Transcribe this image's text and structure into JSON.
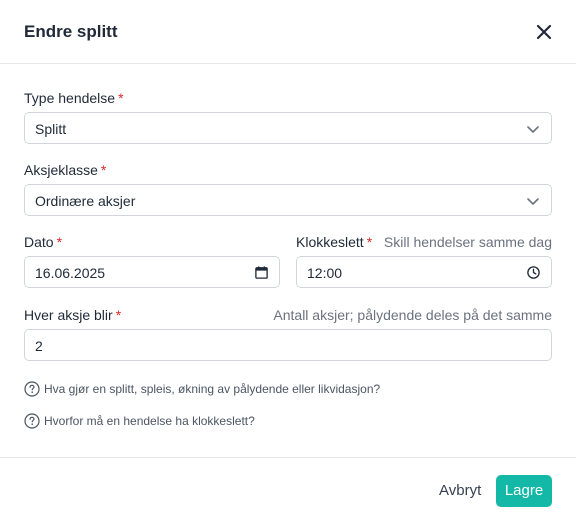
{
  "dialog": {
    "title": "Endre splitt",
    "close_icon": "close-icon"
  },
  "form": {
    "type": {
      "label": "Type hendelse",
      "required_mark": "*",
      "value": "Splitt"
    },
    "share_class": {
      "label": "Aksjeklasse",
      "required_mark": "*",
      "value": "Ordinære aksjer"
    },
    "date": {
      "label": "Dato",
      "required_mark": "*",
      "value": "16.06.2025"
    },
    "time": {
      "label": "Klokkeslett",
      "required_mark": "*",
      "hint": "Skill hendelser samme dag",
      "value": "12:00"
    },
    "each_share": {
      "label": "Hver aksje blir",
      "required_mark": "*",
      "hint": "Antall aksjer; pålydende deles på det samme",
      "value": "2"
    },
    "help_links": [
      {
        "text": "Hva gjør en splitt, spleis, økning av pålydende eller likvidasjon?"
      },
      {
        "text": "Hvorfor må en hendelse ha klokkeslett?"
      }
    ]
  },
  "footer": {
    "cancel_label": "Avbryt",
    "save_label": "Lagre"
  },
  "colors": {
    "accent": "#14b8a6",
    "required": "#dc2626",
    "border": "#d1d5db"
  }
}
